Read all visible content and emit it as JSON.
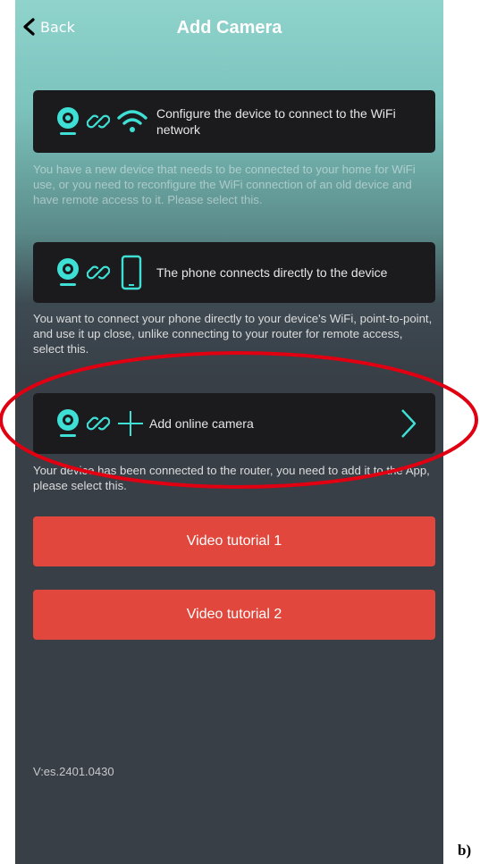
{
  "header": {
    "back_label": "Back",
    "title": "Add Camera"
  },
  "options": [
    {
      "label": "Configure the device to connect to the WiFi network",
      "description": "You have a new device that needs to be connected to your home for WiFi use, or you need to reconfigure the WiFi connection of an old device and have remote access to it. Please select this."
    },
    {
      "label": "The phone connects directly to the device",
      "description": "You want to connect your phone directly to your device's WiFi, point-to-point, and use it up close, unlike connecting to your router for remote access, select this."
    },
    {
      "label": "Add online camera",
      "description": "Your device has been connected to the router, you need to add it to the App, please select this."
    }
  ],
  "buttons": {
    "tutorial1": "Video tutorial 1",
    "tutorial2": "Video tutorial 2"
  },
  "version": "V:es.2401.0430",
  "figure_mark": "b)",
  "colors": {
    "accent_cyan": "#3ee0d6",
    "button_red": "#e1473c",
    "highlight_ellipse": "#e00012"
  }
}
